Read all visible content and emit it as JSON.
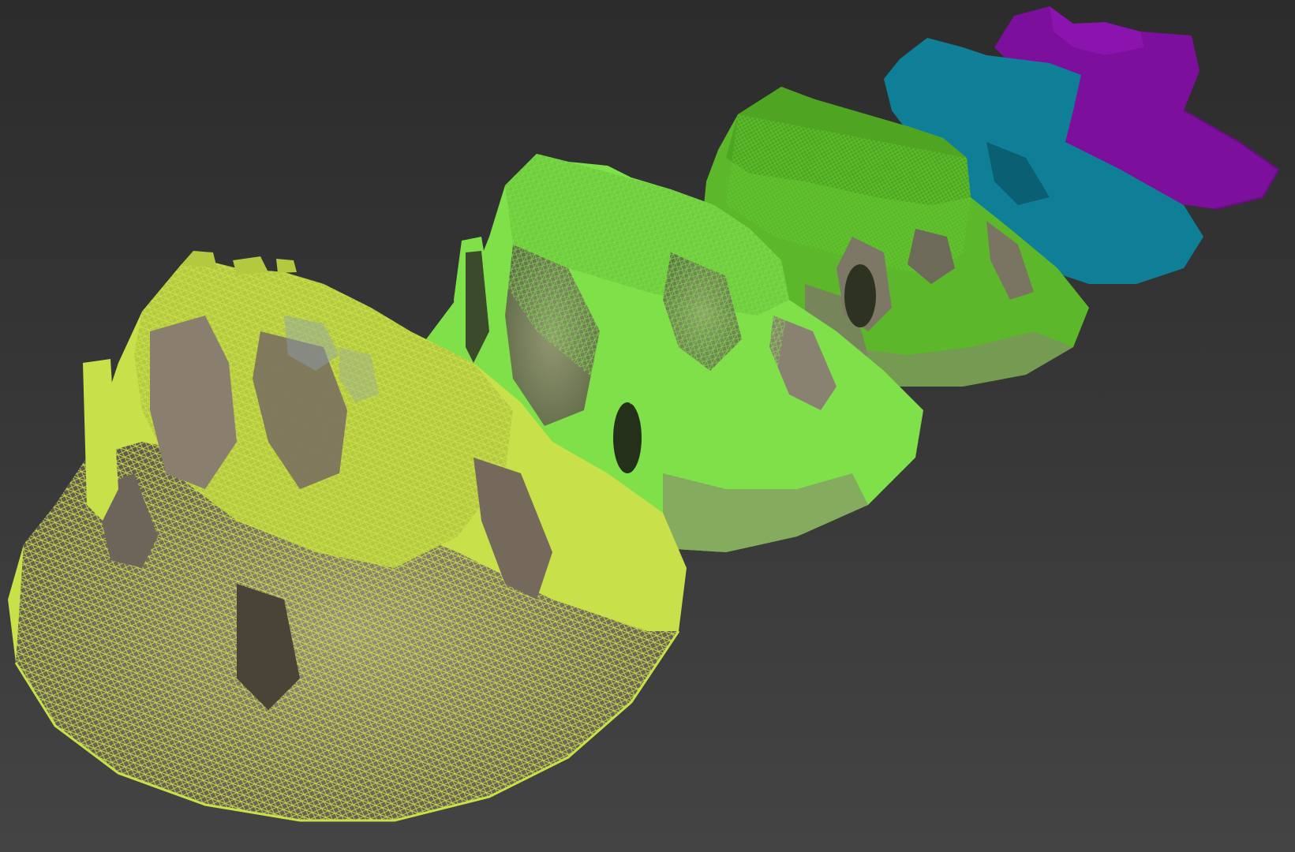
{
  "viewport": {
    "background_top": "#2c2c2c",
    "background_bottom": "#444444"
  },
  "meshes": [
    {
      "id": "mesh-lod0",
      "wire_color": "#c8e04a",
      "fill_color": "#8a7f6e",
      "density": "highest"
    },
    {
      "id": "mesh-lod1",
      "wire_color": "#7fe04a",
      "fill_color": "#8a8270",
      "density": "high"
    },
    {
      "id": "mesh-lod2",
      "wire_color": "#5cb82a",
      "fill_color": "#7d7866",
      "density": "medium"
    },
    {
      "id": "mesh-lod3",
      "wire_color": "#0f7f98",
      "fill_color": "#0f7f98",
      "density": "low"
    },
    {
      "id": "mesh-lod4",
      "wire_color": "#7c0f9c",
      "fill_color": "#7c0f9c",
      "density": "lowest"
    }
  ]
}
